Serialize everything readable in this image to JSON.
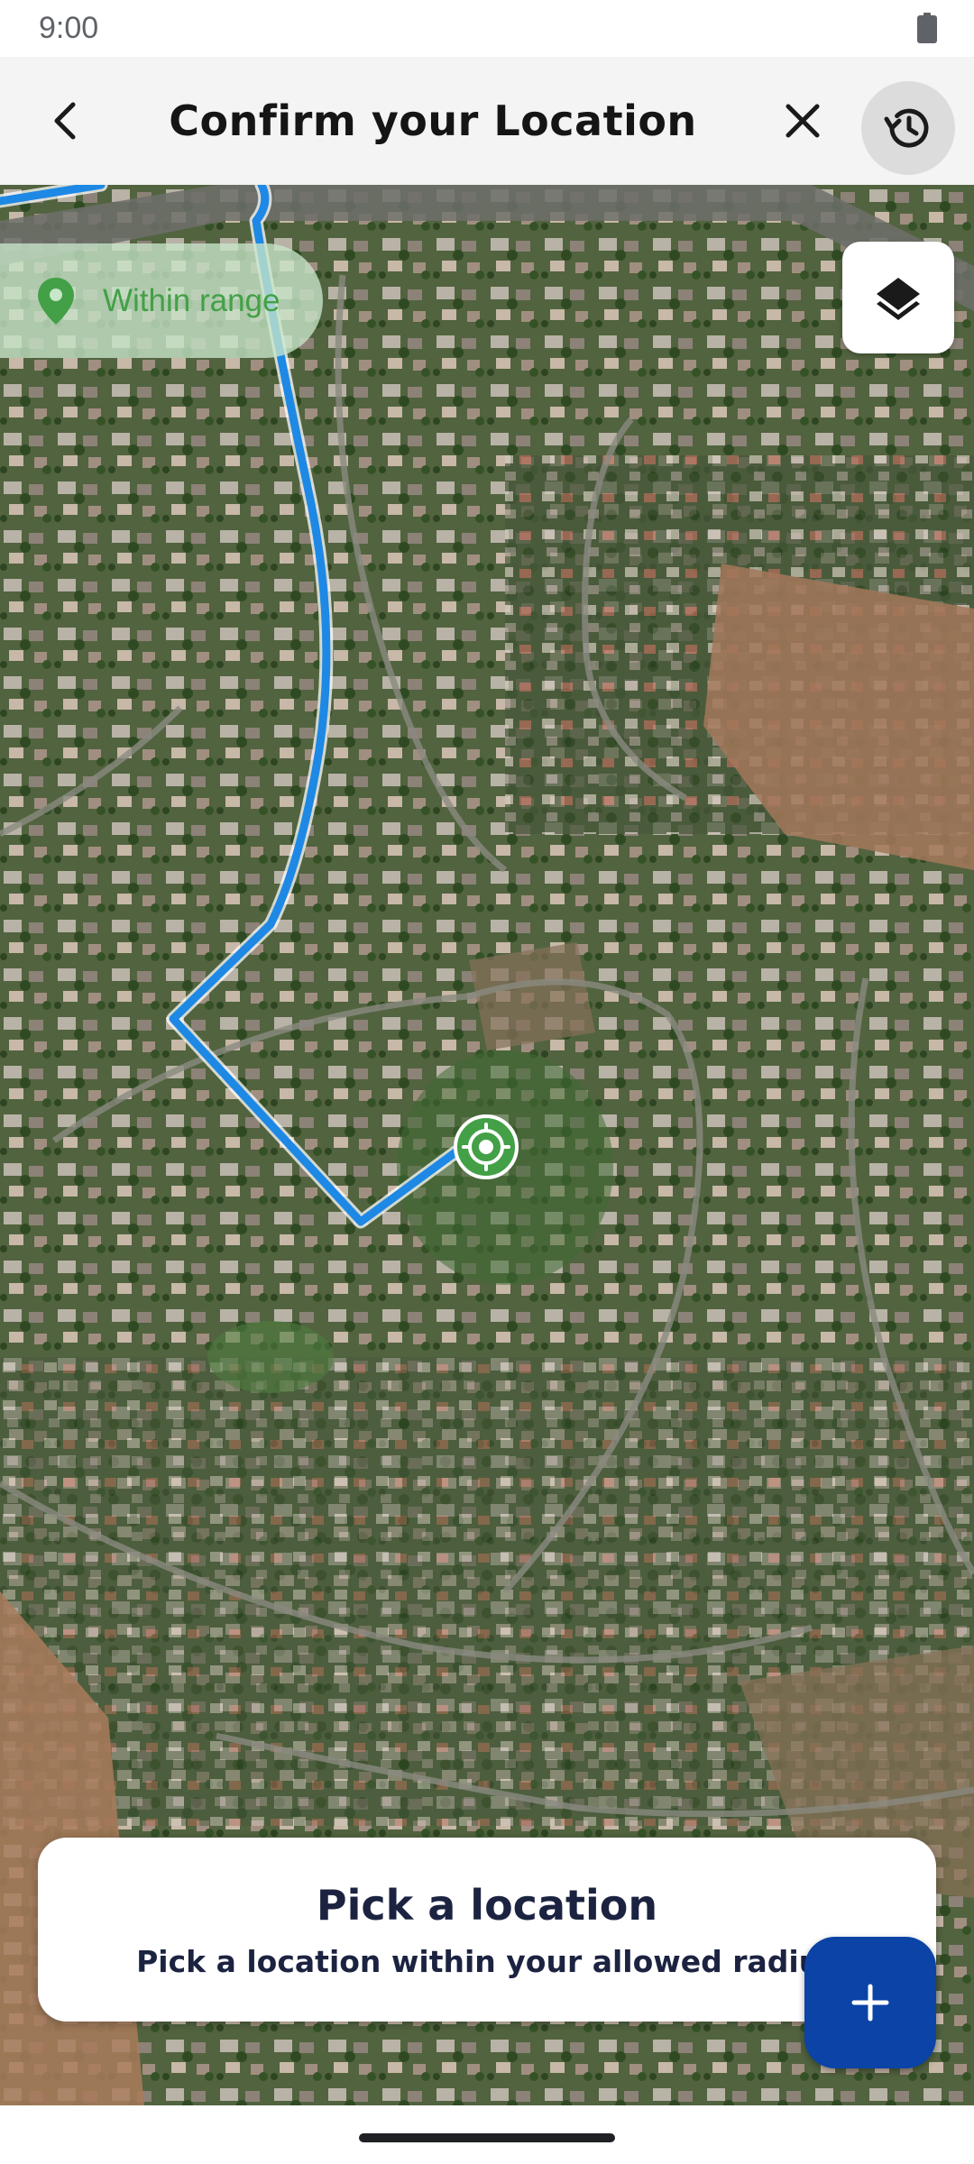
{
  "status_bar": {
    "time": "9:00",
    "battery_icon": "battery-full-icon"
  },
  "header": {
    "title": "Confirm your Location",
    "back_icon": "chevron-left-icon",
    "close_icon": "close-icon",
    "history_icon": "history-icon"
  },
  "map": {
    "range_status": {
      "label": "Within range",
      "icon": "location-pin-icon",
      "color": "#43a047"
    },
    "layers_icon": "layers-icon",
    "route_color": "#1e88e5",
    "marker_icon": "target-location-icon",
    "marker_color": "#43a047"
  },
  "info_card": {
    "title": "Pick a location",
    "subtitle": "Pick a location within your allowed radius"
  },
  "fab": {
    "icon": "plus-icon",
    "color": "#0b43a6"
  }
}
